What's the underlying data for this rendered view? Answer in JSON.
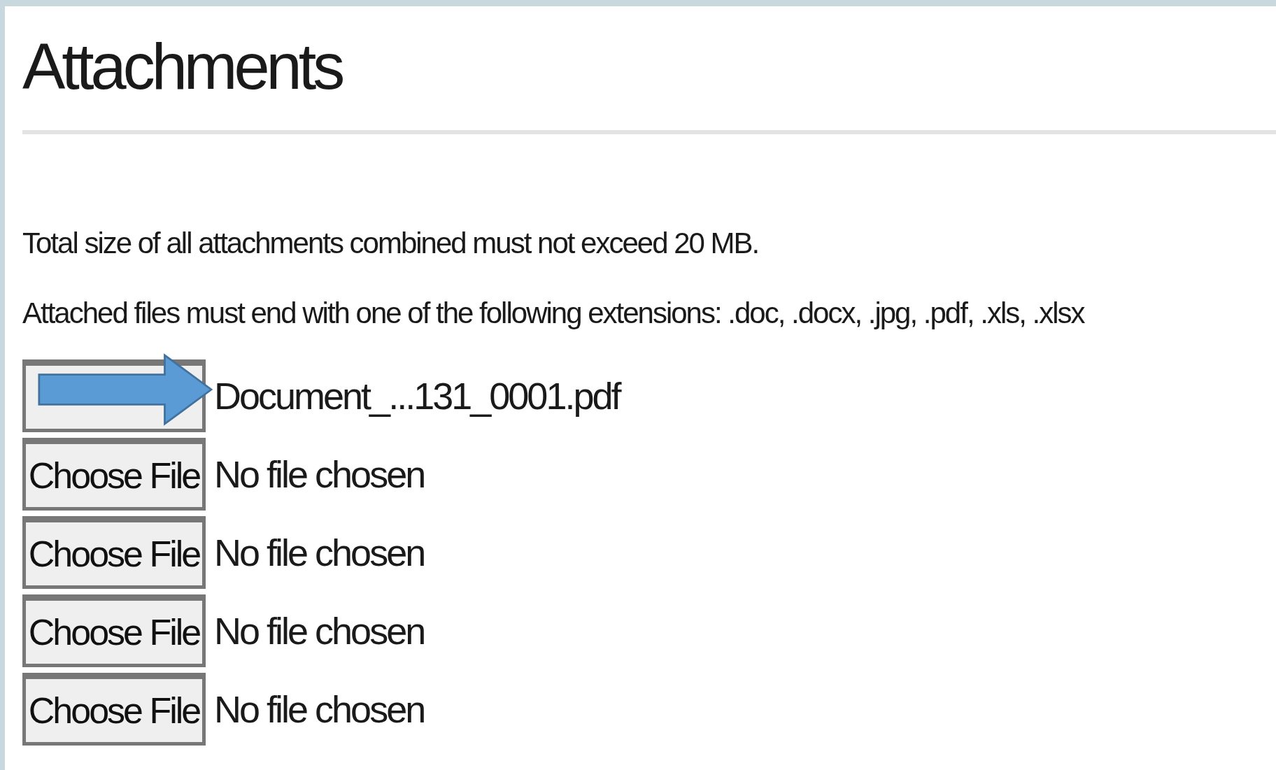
{
  "heading": "Attachments",
  "notes": [
    "Total size of all attachments combined must not exceed 20 MB.",
    "Attached files must end with one of the following extensions: .doc, .docx, .jpg, .pdf, .xls, .xlsx"
  ],
  "file_inputs": [
    {
      "status": "Document_...131_0001.pdf",
      "arrow": true
    },
    {
      "button": "Choose File",
      "status": "No file chosen",
      "arrow": false
    },
    {
      "button": "Choose File",
      "status": "No file chosen",
      "arrow": false
    },
    {
      "button": "Choose File",
      "status": "No file chosen",
      "arrow": false
    },
    {
      "button": "Choose File",
      "status": "No file chosen",
      "arrow": false
    }
  ]
}
